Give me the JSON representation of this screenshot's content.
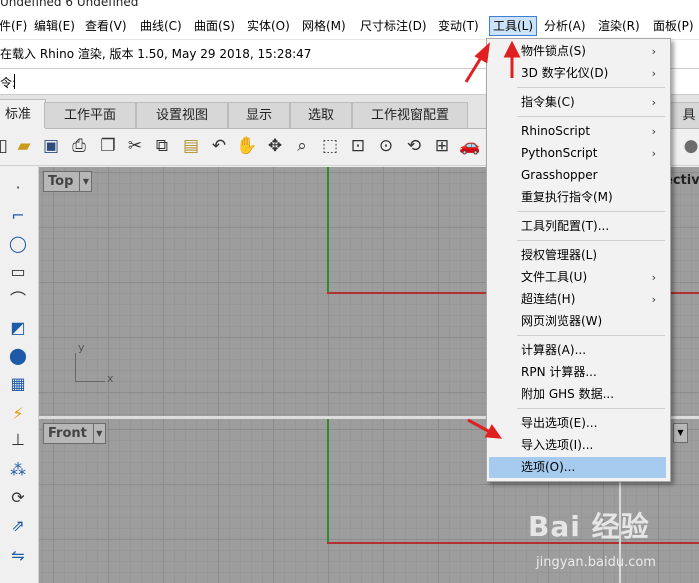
{
  "window": {
    "title": "Undefined 6 Undefined"
  },
  "menubar": {
    "items": [
      "件(F)",
      "编辑(E)",
      "查看(V)",
      "曲线(C)",
      "曲面(S)",
      "实体(O)",
      "网格(M)",
      "尺寸标注(D)",
      "变动(T)",
      "工具(L)",
      "分析(A)",
      "渲染(R)",
      "面板(P)"
    ],
    "active": "工具(L)"
  },
  "command": {
    "history": "在载入 Rhino 渲染, 版本 1.50, May 29 2018, 15:28:47",
    "prompt": "令:"
  },
  "tabs": [
    "标准",
    "工作平面",
    "设置视图",
    "显示",
    "选取",
    "工作视窗配置",
    "具"
  ],
  "selected_tab": "标准",
  "toolbar_icons": [
    "folder-open-icon",
    "save-icon",
    "print-icon",
    "copy-clipboard-icon",
    "cut-icon",
    "copy-icon",
    "paste-icon",
    "undo-icon",
    "pan-hand-icon",
    "rotate-view-icon",
    "zoom-icon",
    "zoom-window-icon",
    "zoom-extents-icon",
    "zoom-selected-icon",
    "rotate-icon",
    "four-viewports-icon",
    "car-render-icon"
  ],
  "left_tools": [
    "point-icon",
    "polyline-icon",
    "circle-icon",
    "rectangle-icon",
    "curve-icon",
    "surface-icon",
    "solid-icon",
    "mesh-icon",
    "transform-icon",
    "boolean-icon",
    "dimension-icon",
    "array-icon",
    "analyze-icon"
  ],
  "viewports": {
    "top": {
      "label": "Top",
      "axis_y": "y",
      "axis_x": "x"
    },
    "front": {
      "label": "Front"
    },
    "perspective": {
      "label": "ectiv"
    }
  },
  "tools_menu": {
    "groups": [
      [
        {
          "label": "物件锁点(S)",
          "submenu": true
        },
        {
          "label": "3D 数字化仪(D)",
          "submenu": true
        }
      ],
      [
        {
          "label": "指令集(C)",
          "submenu": true
        }
      ],
      [
        {
          "label": "RhinoScript",
          "submenu": true
        },
        {
          "label": "PythonScript",
          "submenu": true
        },
        {
          "label": "Grasshopper",
          "submenu": false
        },
        {
          "label": "重复执行指令(M)",
          "submenu": false
        }
      ],
      [
        {
          "label": "工具列配置(T)...",
          "submenu": false
        }
      ],
      [
        {
          "label": "授权管理器(L)",
          "submenu": false
        },
        {
          "label": "文件工具(U)",
          "submenu": true
        },
        {
          "label": "超连结(H)",
          "submenu": true
        },
        {
          "label": "网页浏览器(W)",
          "submenu": false
        }
      ],
      [
        {
          "label": "计算器(A)...",
          "submenu": false
        },
        {
          "label": "RPN 计算器...",
          "submenu": false
        },
        {
          "label": "附加 GHS 数据...",
          "submenu": false
        }
      ],
      [
        {
          "label": "导出选项(E)...",
          "submenu": false
        },
        {
          "label": "导入选项(I)...",
          "submenu": false
        },
        {
          "label": "选项(O)...",
          "submenu": false
        }
      ]
    ],
    "highlighted": "选项(O)..."
  },
  "colors": {
    "menu_highlight": "#a6cbee",
    "annotation_arrow": "#e02020",
    "axis_x": "#b23030",
    "axis_y": "#2e8b2e"
  },
  "watermark": {
    "brand": "Bai 经验",
    "url": "jingyan.baidu.com"
  }
}
